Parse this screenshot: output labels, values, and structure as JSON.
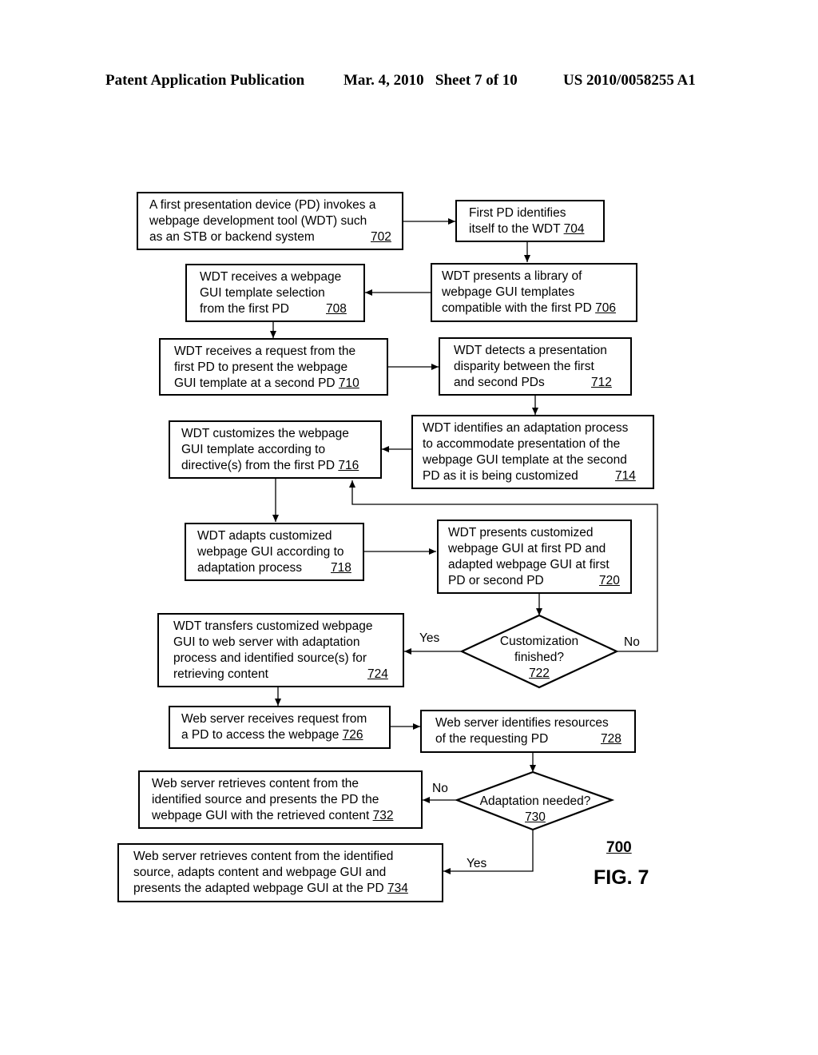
{
  "header": {
    "publication": "Patent Application Publication",
    "date_sheet": "Mar. 4, 2010   Sheet 7 of 10",
    "patent_number": "US 2010/0058255 A1"
  },
  "figure": {
    "ref": "700",
    "label": "FIG. 7"
  },
  "steps": {
    "s702": {
      "lines": [
        "A first presentation device (PD) invokes a",
        "webpage development tool (WDT) such",
        "as an STB or backend system"
      ],
      "num": "702"
    },
    "s704": {
      "lines": [
        "First PD identifies",
        "itself to the WDT"
      ],
      "num": "704"
    },
    "s706": {
      "lines": [
        "WDT presents a library of",
        "webpage GUI templates",
        "compatible with the first PD"
      ],
      "num": "706"
    },
    "s708": {
      "lines": [
        "WDT receives a webpage",
        "GUI template selection",
        "from the first PD"
      ],
      "num": "708"
    },
    "s710": {
      "lines": [
        "WDT receives a request from the",
        "first PD to present the webpage",
        "GUI template at a second PD"
      ],
      "num": "710"
    },
    "s712": {
      "lines": [
        "WDT detects a presentation",
        "disparity between the first",
        "and second PDs"
      ],
      "num": "712"
    },
    "s714": {
      "lines": [
        "WDT identifies an adaptation process",
        "to accommodate presentation of the",
        "webpage GUI template at the second",
        "PD as it is being customized"
      ],
      "num": "714"
    },
    "s716": {
      "lines": [
        "WDT customizes the webpage",
        "GUI template according to",
        "directive(s) from the first PD"
      ],
      "num": "716"
    },
    "s718": {
      "lines": [
        "WDT adapts customized",
        "webpage GUI according to",
        "adaptation process"
      ],
      "num": "718"
    },
    "s720": {
      "lines": [
        "WDT presents customized",
        "webpage GUI at first PD and",
        "adapted webpage GUI at first",
        "PD or second PD"
      ],
      "num": "720"
    },
    "s722": {
      "lines": [
        "Customization",
        "finished?"
      ],
      "num": "722"
    },
    "s724": {
      "lines": [
        "WDT transfers customized webpage",
        "GUI to web server with adaptation",
        "process and identified source(s) for",
        "retrieving content"
      ],
      "num": "724"
    },
    "s726": {
      "lines": [
        "Web server receives request from",
        "a PD to access the webpage"
      ],
      "num": "726"
    },
    "s728": {
      "lines": [
        "Web server identifies resources",
        "of the requesting PD"
      ],
      "num": "728"
    },
    "s730": {
      "lines": [
        "Adaptation needed?"
      ],
      "num": "730"
    },
    "s732": {
      "lines": [
        "Web server retrieves content from the",
        "identified source and presents the PD the",
        "webpage GUI with the retrieved content"
      ],
      "num": "732"
    },
    "s734": {
      "lines": [
        "Web server retrieves content from the identified",
        "source, adapts content and webpage GUI and",
        "presents the adapted webpage GUI at the PD"
      ],
      "num": "734"
    }
  },
  "branch_labels": {
    "d722_yes": "Yes",
    "d722_no": "No",
    "d730_no": "No",
    "d730_yes": "Yes"
  }
}
